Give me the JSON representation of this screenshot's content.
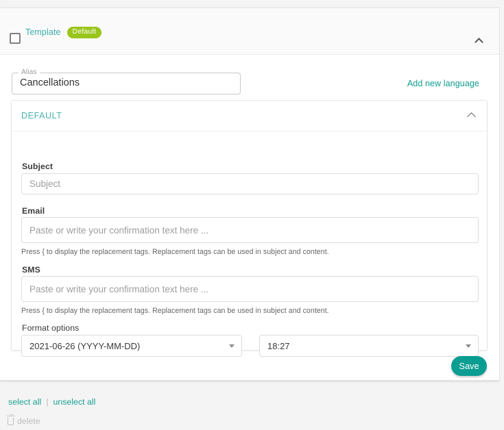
{
  "header": {
    "checkbox_checked": false,
    "template_label": "Template",
    "badge_label": "Default",
    "collapse_icon": "chevron-up-icon"
  },
  "alias": {
    "label": "Alias",
    "value": "Cancellations"
  },
  "actions": {
    "add_new_language": "Add new language",
    "save_label": "Save"
  },
  "section": {
    "title": "DEFAULT",
    "collapse_icon": "chevron-up-icon"
  },
  "fields": {
    "subject": {
      "label": "Subject",
      "value": "",
      "placeholder": "Subject"
    },
    "email": {
      "label": "Email",
      "value": "",
      "placeholder": "Paste or write your confirmation text here ...",
      "helper": "Press { to display the replacement tags. Replacement tags can be used in subject and content."
    },
    "sms": {
      "label": "SMS",
      "value": "",
      "placeholder": "Paste or write your confirmation text here ...",
      "helper": "Press { to display the replacement tags. Replacement tags can be used in subject and content."
    }
  },
  "format_options": {
    "label": "Format options",
    "date_selected": "2021-06-26 (YYYY-MM-DD)",
    "time_selected": "18:27"
  },
  "footer": {
    "select_all": "select all",
    "separator": "|",
    "unselect_all": "unselect all",
    "delete_label": "delete",
    "delete_icon": "trash-icon"
  },
  "colors": {
    "teal": "#0f9b8e",
    "teal_light": "#4bb3ad",
    "badge_green": "#9ac51c",
    "save_teal": "#0a9d91",
    "page_bg": "#f4f4f4"
  }
}
